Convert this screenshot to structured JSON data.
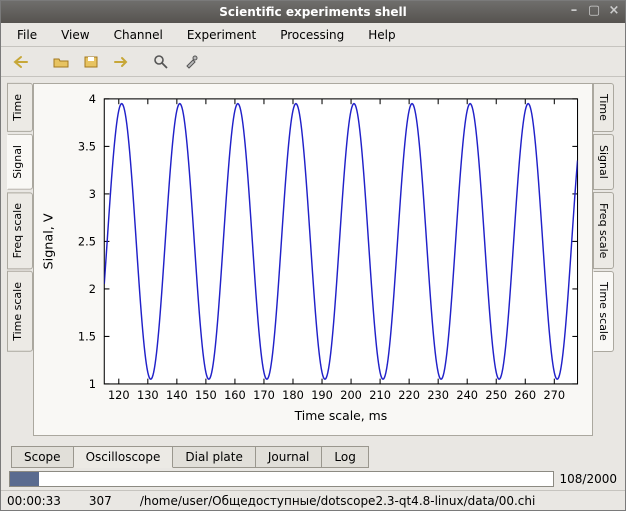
{
  "window": {
    "title": "Scientific experiments shell"
  },
  "menu": {
    "file": "File",
    "view": "View",
    "channel": "Channel",
    "experiment": "Experiment",
    "processing": "Processing",
    "help": "Help"
  },
  "left_tabs": {
    "time": "Time",
    "signal": "Signal",
    "freq": "Freq scale",
    "tscale": "Time scale"
  },
  "right_tabs": {
    "time": "Time",
    "signal": "Signal",
    "freq": "Freq scale",
    "tscale": "Time scale"
  },
  "bottom_tabs": {
    "scope": "Scope",
    "osc": "Oscilloscope",
    "dial": "Dial plate",
    "journal": "Journal",
    "log": "Log"
  },
  "progress": {
    "text": "108/2000"
  },
  "status": {
    "time": "00:00:33",
    "count": "307",
    "path": "/home/user/Общедоступные/dotscope2.3-qt4.8-linux/data/00.chi"
  },
  "chart_data": {
    "type": "line",
    "title": "",
    "xlabel": "Time scale, ms",
    "ylabel": "Signal, V",
    "xlim": [
      115,
      278
    ],
    "ylim": [
      1,
      4
    ],
    "xticks": [
      120,
      130,
      140,
      150,
      160,
      170,
      180,
      190,
      200,
      210,
      220,
      230,
      240,
      250,
      260,
      270
    ],
    "yticks": [
      1,
      1.5,
      2,
      2.5,
      3,
      3.5,
      4
    ],
    "series": [
      {
        "name": "signal",
        "color": "#2121c9",
        "amplitude": 1.45,
        "offset": 2.5,
        "period_ms": 20,
        "phase_ms": 116,
        "sample_points": [
          {
            "x": 120,
            "y": 3.92
          },
          {
            "x": 125,
            "y": 2.5
          },
          {
            "x": 130,
            "y": 1.1
          },
          {
            "x": 135,
            "y": 2.5
          },
          {
            "x": 140,
            "y": 3.92
          },
          {
            "x": 145,
            "y": 2.5
          },
          {
            "x": 150,
            "y": 1.1
          },
          {
            "x": 155,
            "y": 2.5
          },
          {
            "x": 160,
            "y": 3.92
          },
          {
            "x": 165,
            "y": 2.5
          },
          {
            "x": 170,
            "y": 1.1
          },
          {
            "x": 175,
            "y": 2.5
          },
          {
            "x": 180,
            "y": 3.9
          },
          {
            "x": 185,
            "y": 2.5
          },
          {
            "x": 190,
            "y": 1.1
          },
          {
            "x": 195,
            "y": 2.5
          },
          {
            "x": 200,
            "y": 3.9
          },
          {
            "x": 205,
            "y": 2.5
          },
          {
            "x": 210,
            "y": 1.1
          },
          {
            "x": 215,
            "y": 2.5
          },
          {
            "x": 220,
            "y": 3.88
          },
          {
            "x": 225,
            "y": 2.5
          },
          {
            "x": 230,
            "y": 1.1
          },
          {
            "x": 235,
            "y": 2.5
          },
          {
            "x": 240,
            "y": 3.88
          },
          {
            "x": 245,
            "y": 2.5
          },
          {
            "x": 250,
            "y": 1.12
          },
          {
            "x": 255,
            "y": 2.5
          },
          {
            "x": 260,
            "y": 3.88
          },
          {
            "x": 265,
            "y": 2.5
          },
          {
            "x": 270,
            "y": 1.12
          },
          {
            "x": 275,
            "y": 2.5
          }
        ]
      }
    ]
  }
}
